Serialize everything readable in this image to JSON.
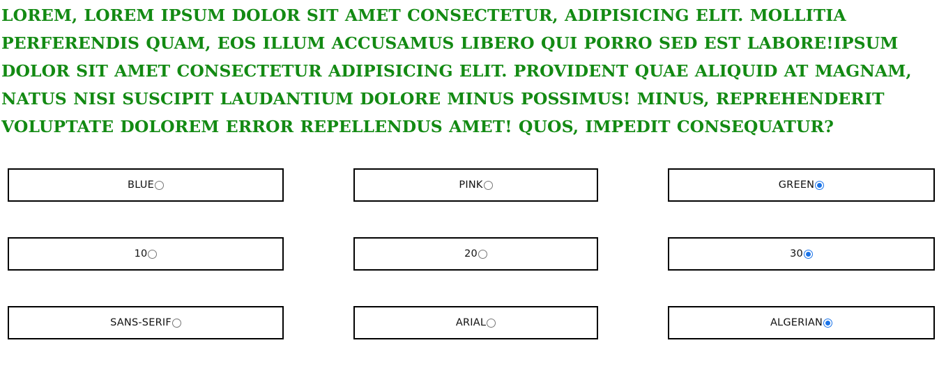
{
  "preview": {
    "text": "Lorem, lorem ipsum dolor sit amet consectetur, adipisicing elit. Mollitia perferendis quam, eos illum accusamus libero qui porro sed est labore!Ipsum dolor sit amet consectetur adipisicing elit. Provident quae aliquid at magnam, natus nisi suscipit laudantium dolore minus possimus! Minus, reprehenderit voluptate dolorem error repellendus amet! Quos, impedit consequatur?",
    "color": "#138a13"
  },
  "options": {
    "color": [
      {
        "label": "BLUE",
        "checked": false
      },
      {
        "label": "PINK",
        "checked": false
      },
      {
        "label": "GREEN",
        "checked": true
      }
    ],
    "size": [
      {
        "label": "10",
        "checked": false
      },
      {
        "label": "20",
        "checked": false
      },
      {
        "label": "30",
        "checked": true
      }
    ],
    "font": [
      {
        "label": "SANS-SERIF",
        "checked": false
      },
      {
        "label": "ARIAL",
        "checked": false
      },
      {
        "label": "ALGERIAN",
        "checked": true
      }
    ]
  },
  "accent_color": "#1a73e8"
}
